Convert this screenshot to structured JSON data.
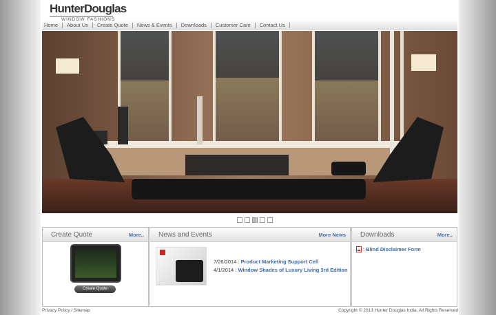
{
  "brand": {
    "name": "HunterDouglas",
    "tagline": "WINDOW FASHIONS"
  },
  "nav": [
    "Home",
    "About Us",
    "Create Quote",
    "News & Events",
    "Downloads",
    "Customer Care",
    "Contact Us"
  ],
  "slider": {
    "total": 5,
    "active": 3
  },
  "create_quote": {
    "title": "Create Quote",
    "more": "More..",
    "button": "Create Quote"
  },
  "news": {
    "title": "News and Events",
    "more": "More News",
    "items": [
      {
        "date": "7/26/2014 :",
        "title": "Product Marketing Support Cell"
      },
      {
        "date": "4/1/2014 :",
        "title": "Window Shades of Luxury Living 3rd Edition"
      }
    ]
  },
  "downloads": {
    "title": "Downloads",
    "more": "More..",
    "items": [
      {
        "prefix": ":",
        "label": "Blind Disclaimer Form"
      }
    ]
  },
  "footer": {
    "left": "Privacy Policy / Sitemap",
    "right": "Copyright © 2013 Hunter Douglas India. All Rights Reserved"
  }
}
